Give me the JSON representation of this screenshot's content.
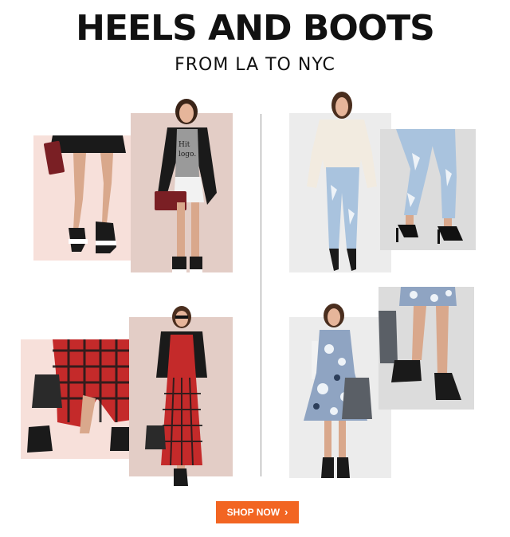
{
  "headline": "HEELS AND BOOTS",
  "subheadline": "FROM LA TO NYC",
  "shop_button": {
    "label": "SHOP NOW",
    "icon": "chevron-right-icon"
  },
  "colors": {
    "accent": "#f26522",
    "panel_pink": "#f7e0da",
    "panel_mauve": "#e3cdc6",
    "panel_gray": "#ececec",
    "panel_gray_dark": "#dcdcdc",
    "headline": "#111111"
  },
  "outfits": [
    {
      "id": "la-top-closeup",
      "name": "Black skirt with platform heels close-up"
    },
    {
      "id": "la-top-model",
      "name": "Model in graphic tee, black cardigan and platform heels"
    },
    {
      "id": "nyc-top-model",
      "name": "Model in cream sweater and distressed jeans"
    },
    {
      "id": "nyc-top-closeup",
      "name": "Distressed jeans with black pumps close-up"
    },
    {
      "id": "la-bottom-closeup",
      "name": "Plaid maxi skirt with peep-toe booties close-up"
    },
    {
      "id": "la-bottom-model",
      "name": "Model in leather jacket and plaid dress"
    },
    {
      "id": "nyc-bottom-model",
      "name": "Model in printed dress with ankle boots"
    },
    {
      "id": "nyc-bottom-closeup",
      "name": "Printed dress with ankle boots close-up"
    }
  ]
}
